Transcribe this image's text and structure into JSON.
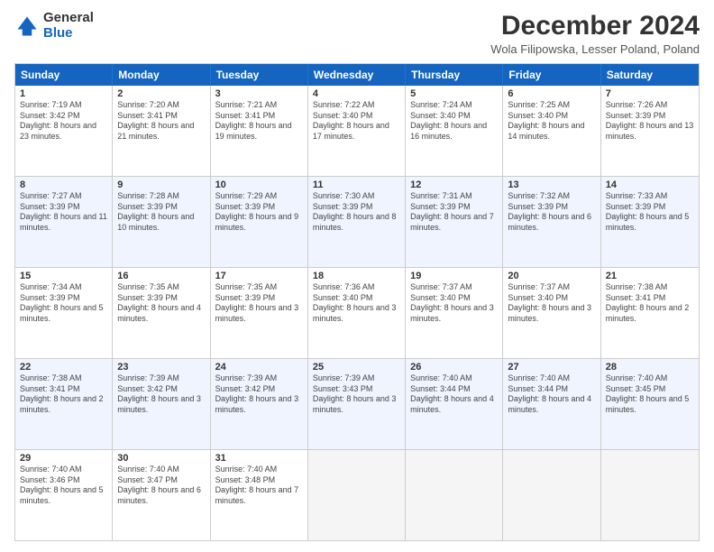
{
  "logo": {
    "general": "General",
    "blue": "Blue"
  },
  "title": "December 2024",
  "location": "Wola Filipowska, Lesser Poland, Poland",
  "days": [
    "Sunday",
    "Monday",
    "Tuesday",
    "Wednesday",
    "Thursday",
    "Friday",
    "Saturday"
  ],
  "weeks": [
    [
      {
        "num": "1",
        "sunrise": "Sunrise: 7:19 AM",
        "sunset": "Sunset: 3:42 PM",
        "daylight": "Daylight: 8 hours and 23 minutes."
      },
      {
        "num": "2",
        "sunrise": "Sunrise: 7:20 AM",
        "sunset": "Sunset: 3:41 PM",
        "daylight": "Daylight: 8 hours and 21 minutes."
      },
      {
        "num": "3",
        "sunrise": "Sunrise: 7:21 AM",
        "sunset": "Sunset: 3:41 PM",
        "daylight": "Daylight: 8 hours and 19 minutes."
      },
      {
        "num": "4",
        "sunrise": "Sunrise: 7:22 AM",
        "sunset": "Sunset: 3:40 PM",
        "daylight": "Daylight: 8 hours and 17 minutes."
      },
      {
        "num": "5",
        "sunrise": "Sunrise: 7:24 AM",
        "sunset": "Sunset: 3:40 PM",
        "daylight": "Daylight: 8 hours and 16 minutes."
      },
      {
        "num": "6",
        "sunrise": "Sunrise: 7:25 AM",
        "sunset": "Sunset: 3:40 PM",
        "daylight": "Daylight: 8 hours and 14 minutes."
      },
      {
        "num": "7",
        "sunrise": "Sunrise: 7:26 AM",
        "sunset": "Sunset: 3:39 PM",
        "daylight": "Daylight: 8 hours and 13 minutes."
      }
    ],
    [
      {
        "num": "8",
        "sunrise": "Sunrise: 7:27 AM",
        "sunset": "Sunset: 3:39 PM",
        "daylight": "Daylight: 8 hours and 11 minutes."
      },
      {
        "num": "9",
        "sunrise": "Sunrise: 7:28 AM",
        "sunset": "Sunset: 3:39 PM",
        "daylight": "Daylight: 8 hours and 10 minutes."
      },
      {
        "num": "10",
        "sunrise": "Sunrise: 7:29 AM",
        "sunset": "Sunset: 3:39 PM",
        "daylight": "Daylight: 8 hours and 9 minutes."
      },
      {
        "num": "11",
        "sunrise": "Sunrise: 7:30 AM",
        "sunset": "Sunset: 3:39 PM",
        "daylight": "Daylight: 8 hours and 8 minutes."
      },
      {
        "num": "12",
        "sunrise": "Sunrise: 7:31 AM",
        "sunset": "Sunset: 3:39 PM",
        "daylight": "Daylight: 8 hours and 7 minutes."
      },
      {
        "num": "13",
        "sunrise": "Sunrise: 7:32 AM",
        "sunset": "Sunset: 3:39 PM",
        "daylight": "Daylight: 8 hours and 6 minutes."
      },
      {
        "num": "14",
        "sunrise": "Sunrise: 7:33 AM",
        "sunset": "Sunset: 3:39 PM",
        "daylight": "Daylight: 8 hours and 5 minutes."
      }
    ],
    [
      {
        "num": "15",
        "sunrise": "Sunrise: 7:34 AM",
        "sunset": "Sunset: 3:39 PM",
        "daylight": "Daylight: 8 hours and 5 minutes."
      },
      {
        "num": "16",
        "sunrise": "Sunrise: 7:35 AM",
        "sunset": "Sunset: 3:39 PM",
        "daylight": "Daylight: 8 hours and 4 minutes."
      },
      {
        "num": "17",
        "sunrise": "Sunrise: 7:35 AM",
        "sunset": "Sunset: 3:39 PM",
        "daylight": "Daylight: 8 hours and 3 minutes."
      },
      {
        "num": "18",
        "sunrise": "Sunrise: 7:36 AM",
        "sunset": "Sunset: 3:40 PM",
        "daylight": "Daylight: 8 hours and 3 minutes."
      },
      {
        "num": "19",
        "sunrise": "Sunrise: 7:37 AM",
        "sunset": "Sunset: 3:40 PM",
        "daylight": "Daylight: 8 hours and 3 minutes."
      },
      {
        "num": "20",
        "sunrise": "Sunrise: 7:37 AM",
        "sunset": "Sunset: 3:40 PM",
        "daylight": "Daylight: 8 hours and 3 minutes."
      },
      {
        "num": "21",
        "sunrise": "Sunrise: 7:38 AM",
        "sunset": "Sunset: 3:41 PM",
        "daylight": "Daylight: 8 hours and 2 minutes."
      }
    ],
    [
      {
        "num": "22",
        "sunrise": "Sunrise: 7:38 AM",
        "sunset": "Sunset: 3:41 PM",
        "daylight": "Daylight: 8 hours and 2 minutes."
      },
      {
        "num": "23",
        "sunrise": "Sunrise: 7:39 AM",
        "sunset": "Sunset: 3:42 PM",
        "daylight": "Daylight: 8 hours and 3 minutes."
      },
      {
        "num": "24",
        "sunrise": "Sunrise: 7:39 AM",
        "sunset": "Sunset: 3:42 PM",
        "daylight": "Daylight: 8 hours and 3 minutes."
      },
      {
        "num": "25",
        "sunrise": "Sunrise: 7:39 AM",
        "sunset": "Sunset: 3:43 PM",
        "daylight": "Daylight: 8 hours and 3 minutes."
      },
      {
        "num": "26",
        "sunrise": "Sunrise: 7:40 AM",
        "sunset": "Sunset: 3:44 PM",
        "daylight": "Daylight: 8 hours and 4 minutes."
      },
      {
        "num": "27",
        "sunrise": "Sunrise: 7:40 AM",
        "sunset": "Sunset: 3:44 PM",
        "daylight": "Daylight: 8 hours and 4 minutes."
      },
      {
        "num": "28",
        "sunrise": "Sunrise: 7:40 AM",
        "sunset": "Sunset: 3:45 PM",
        "daylight": "Daylight: 8 hours and 5 minutes."
      }
    ],
    [
      {
        "num": "29",
        "sunrise": "Sunrise: 7:40 AM",
        "sunset": "Sunset: 3:46 PM",
        "daylight": "Daylight: 8 hours and 5 minutes."
      },
      {
        "num": "30",
        "sunrise": "Sunrise: 7:40 AM",
        "sunset": "Sunset: 3:47 PM",
        "daylight": "Daylight: 8 hours and 6 minutes."
      },
      {
        "num": "31",
        "sunrise": "Sunrise: 7:40 AM",
        "sunset": "Sunset: 3:48 PM",
        "daylight": "Daylight: 8 hours and 7 minutes."
      },
      null,
      null,
      null,
      null
    ]
  ]
}
